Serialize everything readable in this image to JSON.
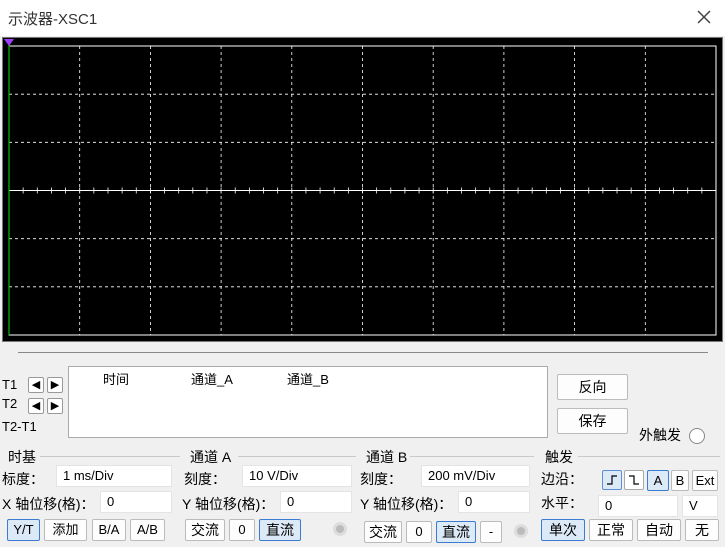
{
  "window": {
    "title": "示波器-XSC1"
  },
  "cursors": {
    "t1_label": "T1",
    "t2_label": "T2",
    "diff_label": "T2-T1"
  },
  "readout": {
    "col_time": "时间",
    "col_a": "通道_A",
    "col_b": "通道_B"
  },
  "actions": {
    "reverse": "反向",
    "save": "保存",
    "ext_trigger": "外触发"
  },
  "timebase": {
    "title": "时基",
    "scale_label": "标度：",
    "scale_value": "1 ms/Div",
    "xpos_label": "X 轴位移(格)：",
    "xpos_value": "0",
    "modes": [
      "Y/T",
      "添加",
      "B/A",
      "A/B"
    ]
  },
  "channel_a": {
    "title": "通道 A",
    "scale_label": "刻度：",
    "scale_value": "10  V/Div",
    "ypos_label": "Y 轴位移(格)：",
    "ypos_value": "0",
    "coupling": [
      "交流",
      "0",
      "直流"
    ]
  },
  "channel_b": {
    "title": "通道 B",
    "scale_label": "刻度：",
    "scale_value": "200 mV/Div",
    "ypos_label": "Y 轴位移(格)：",
    "ypos_value": "0",
    "coupling": [
      "交流",
      "0",
      "直流",
      "-"
    ]
  },
  "trigger": {
    "title": "触发",
    "edge_label": "边沿：",
    "sources": [
      "A",
      "B",
      "Ext"
    ],
    "level_label": "水平：",
    "level_value": "0",
    "level_unit": "V",
    "modes": [
      "单次",
      "正常",
      "自动",
      "无"
    ]
  },
  "colors": {
    "screen_bg": "#000000",
    "grid": "#ffffff",
    "trace_a": "#00c000",
    "marker": "#a040ff"
  }
}
